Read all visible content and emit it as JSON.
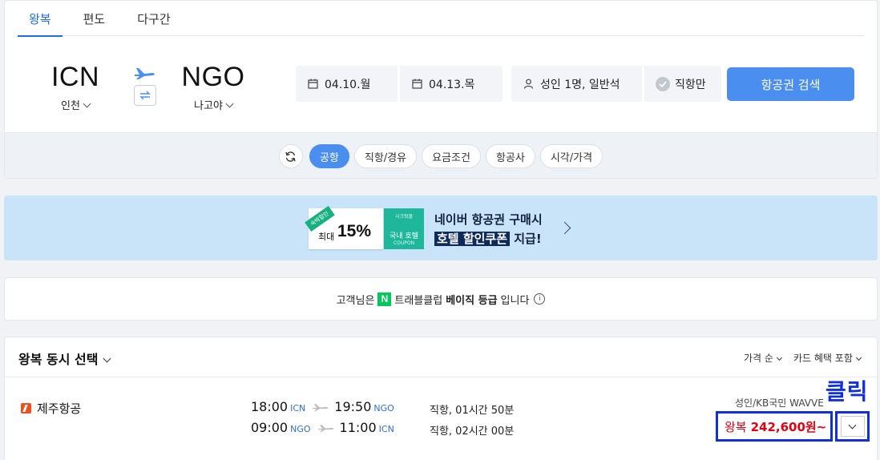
{
  "trip_tabs": [
    "왕복",
    "편도",
    "다구간"
  ],
  "route": {
    "origin_code": "ICN",
    "origin_city": "인천",
    "dest_code": "NGO",
    "dest_city": "나고야"
  },
  "search": {
    "depart_date": "04.10.월",
    "return_date": "04.13.목",
    "passengers": "성인 1명, 일반석",
    "direct_only": "직항만",
    "search_button": "항공권 검색"
  },
  "filters": [
    "공항",
    "직항/경유",
    "요금조건",
    "항공사",
    "시각/가격"
  ],
  "banner": {
    "ribbon": "숙박할인",
    "max_label": "최대",
    "percent": "15%",
    "coupon_top": "시크릿몰",
    "coupon_mid": "국내 호텔",
    "coupon_bottom": "COUPON",
    "line1": "네이버 항공권 구매시",
    "line2_highlight": "호텔 할인쿠폰",
    "line2_rest": " 지급!"
  },
  "membership": {
    "prefix": "고객님은",
    "n_logo": "N",
    "club": "트래블클럽",
    "grade": "베이직 등급",
    "suffix": "입니다",
    "info": "i"
  },
  "results": {
    "select_mode": "왕복 동시 선택",
    "sort_price": "가격 순",
    "sort_card": "카드 혜택 포함"
  },
  "flight": {
    "airline": "제주항공",
    "outbound": {
      "dep_time": "18:00",
      "dep_ap": "ICN",
      "arr_time": "19:50",
      "arr_ap": "NGO",
      "info": "직항, 01시간 50분"
    },
    "inbound": {
      "dep_time": "09:00",
      "dep_ap": "NGO",
      "arr_time": "11:00",
      "arr_ap": "ICN",
      "info": "직항, 02시간 00분"
    },
    "card_note": "성인/KB국민 WAVVE",
    "price_prefix": "왕복",
    "price": "242,600원~"
  },
  "annotation": {
    "click_label": "클릭"
  },
  "colors": {
    "accent": "#4a8ef0",
    "tab_active": "#1f6fe0",
    "price": "#e60012",
    "annotation": "#1030e0"
  }
}
